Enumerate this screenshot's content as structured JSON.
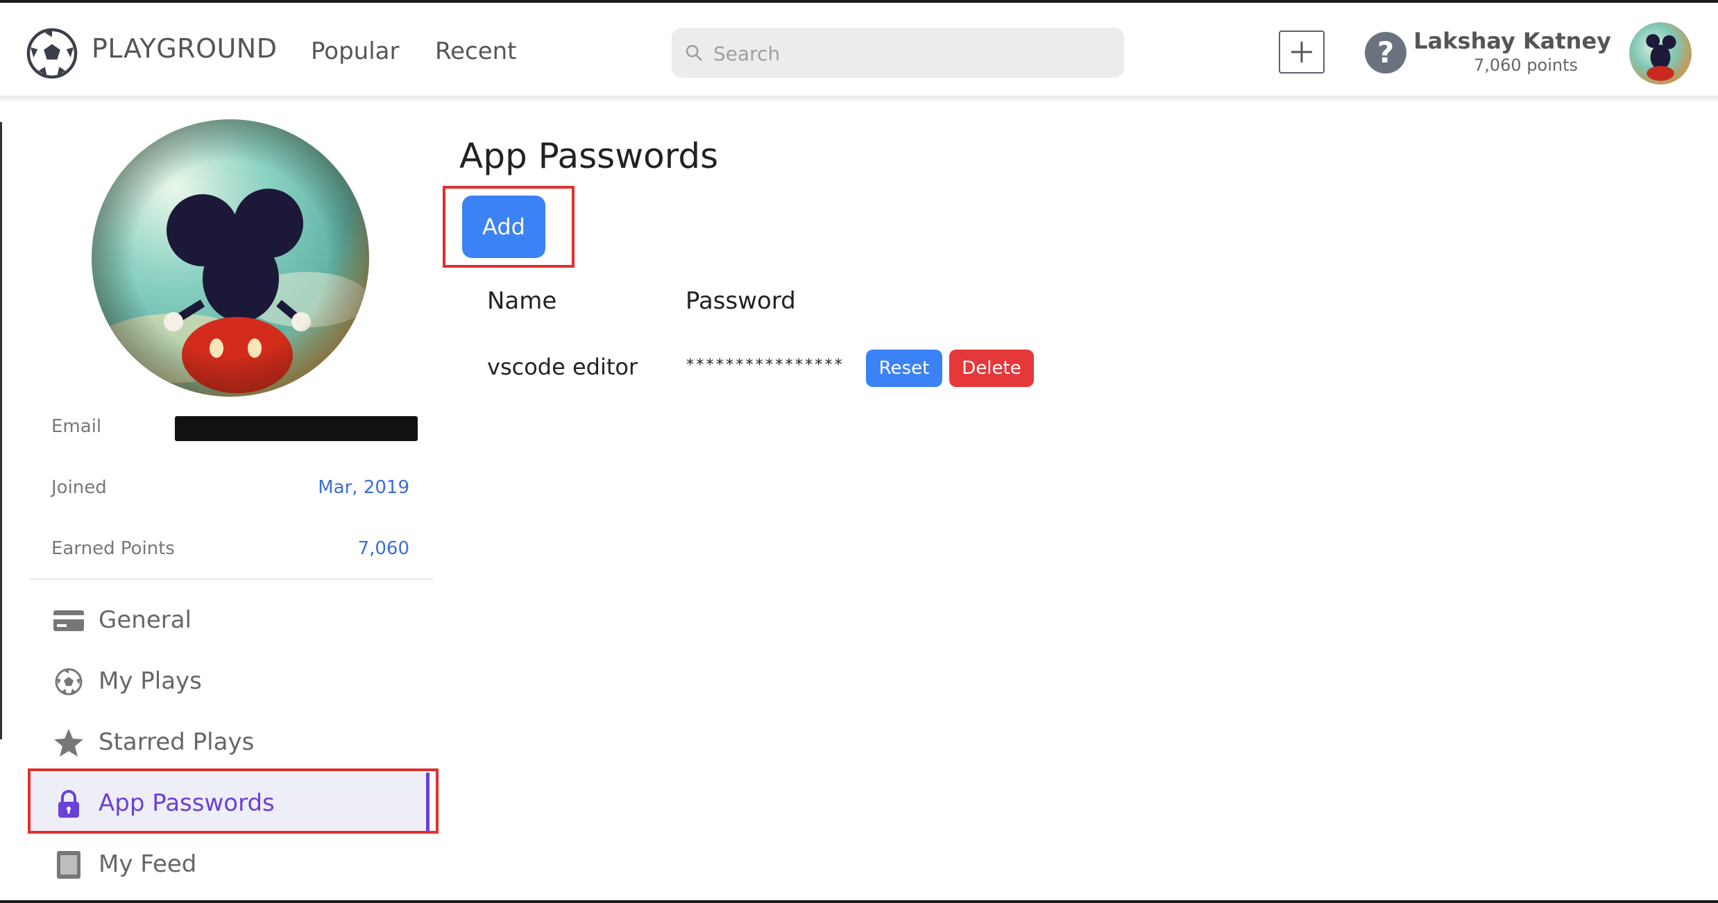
{
  "header": {
    "brand": "PLAYGROUND",
    "nav": [
      "Popular",
      "Recent"
    ],
    "search_placeholder": "Search",
    "user_name": "Lakshay Katney",
    "user_points": "7,060 points"
  },
  "profile": {
    "email_label": "Email",
    "joined_label": "Joined",
    "joined_value": "Mar, 2019",
    "points_label": "Earned Points",
    "points_value": "7,060"
  },
  "menu": [
    {
      "label": "General",
      "icon": "card-icon"
    },
    {
      "label": "My Plays",
      "icon": "soccer-ball-icon"
    },
    {
      "label": "Starred Plays",
      "icon": "star-icon"
    },
    {
      "label": "App Passwords",
      "icon": "lock-icon",
      "active": true
    },
    {
      "label": "My Feed",
      "icon": "feed-icon"
    }
  ],
  "main": {
    "title": "App Passwords",
    "add_label": "Add",
    "columns": [
      "Name",
      "Password"
    ],
    "rows": [
      {
        "name": "vscode editor",
        "password": "****************",
        "reset_label": "Reset",
        "delete_label": "Delete"
      }
    ]
  },
  "colors": {
    "accent": "#6a40d6",
    "primary": "#3b82f6",
    "danger": "#e5383b",
    "highlight": "#e03030"
  }
}
